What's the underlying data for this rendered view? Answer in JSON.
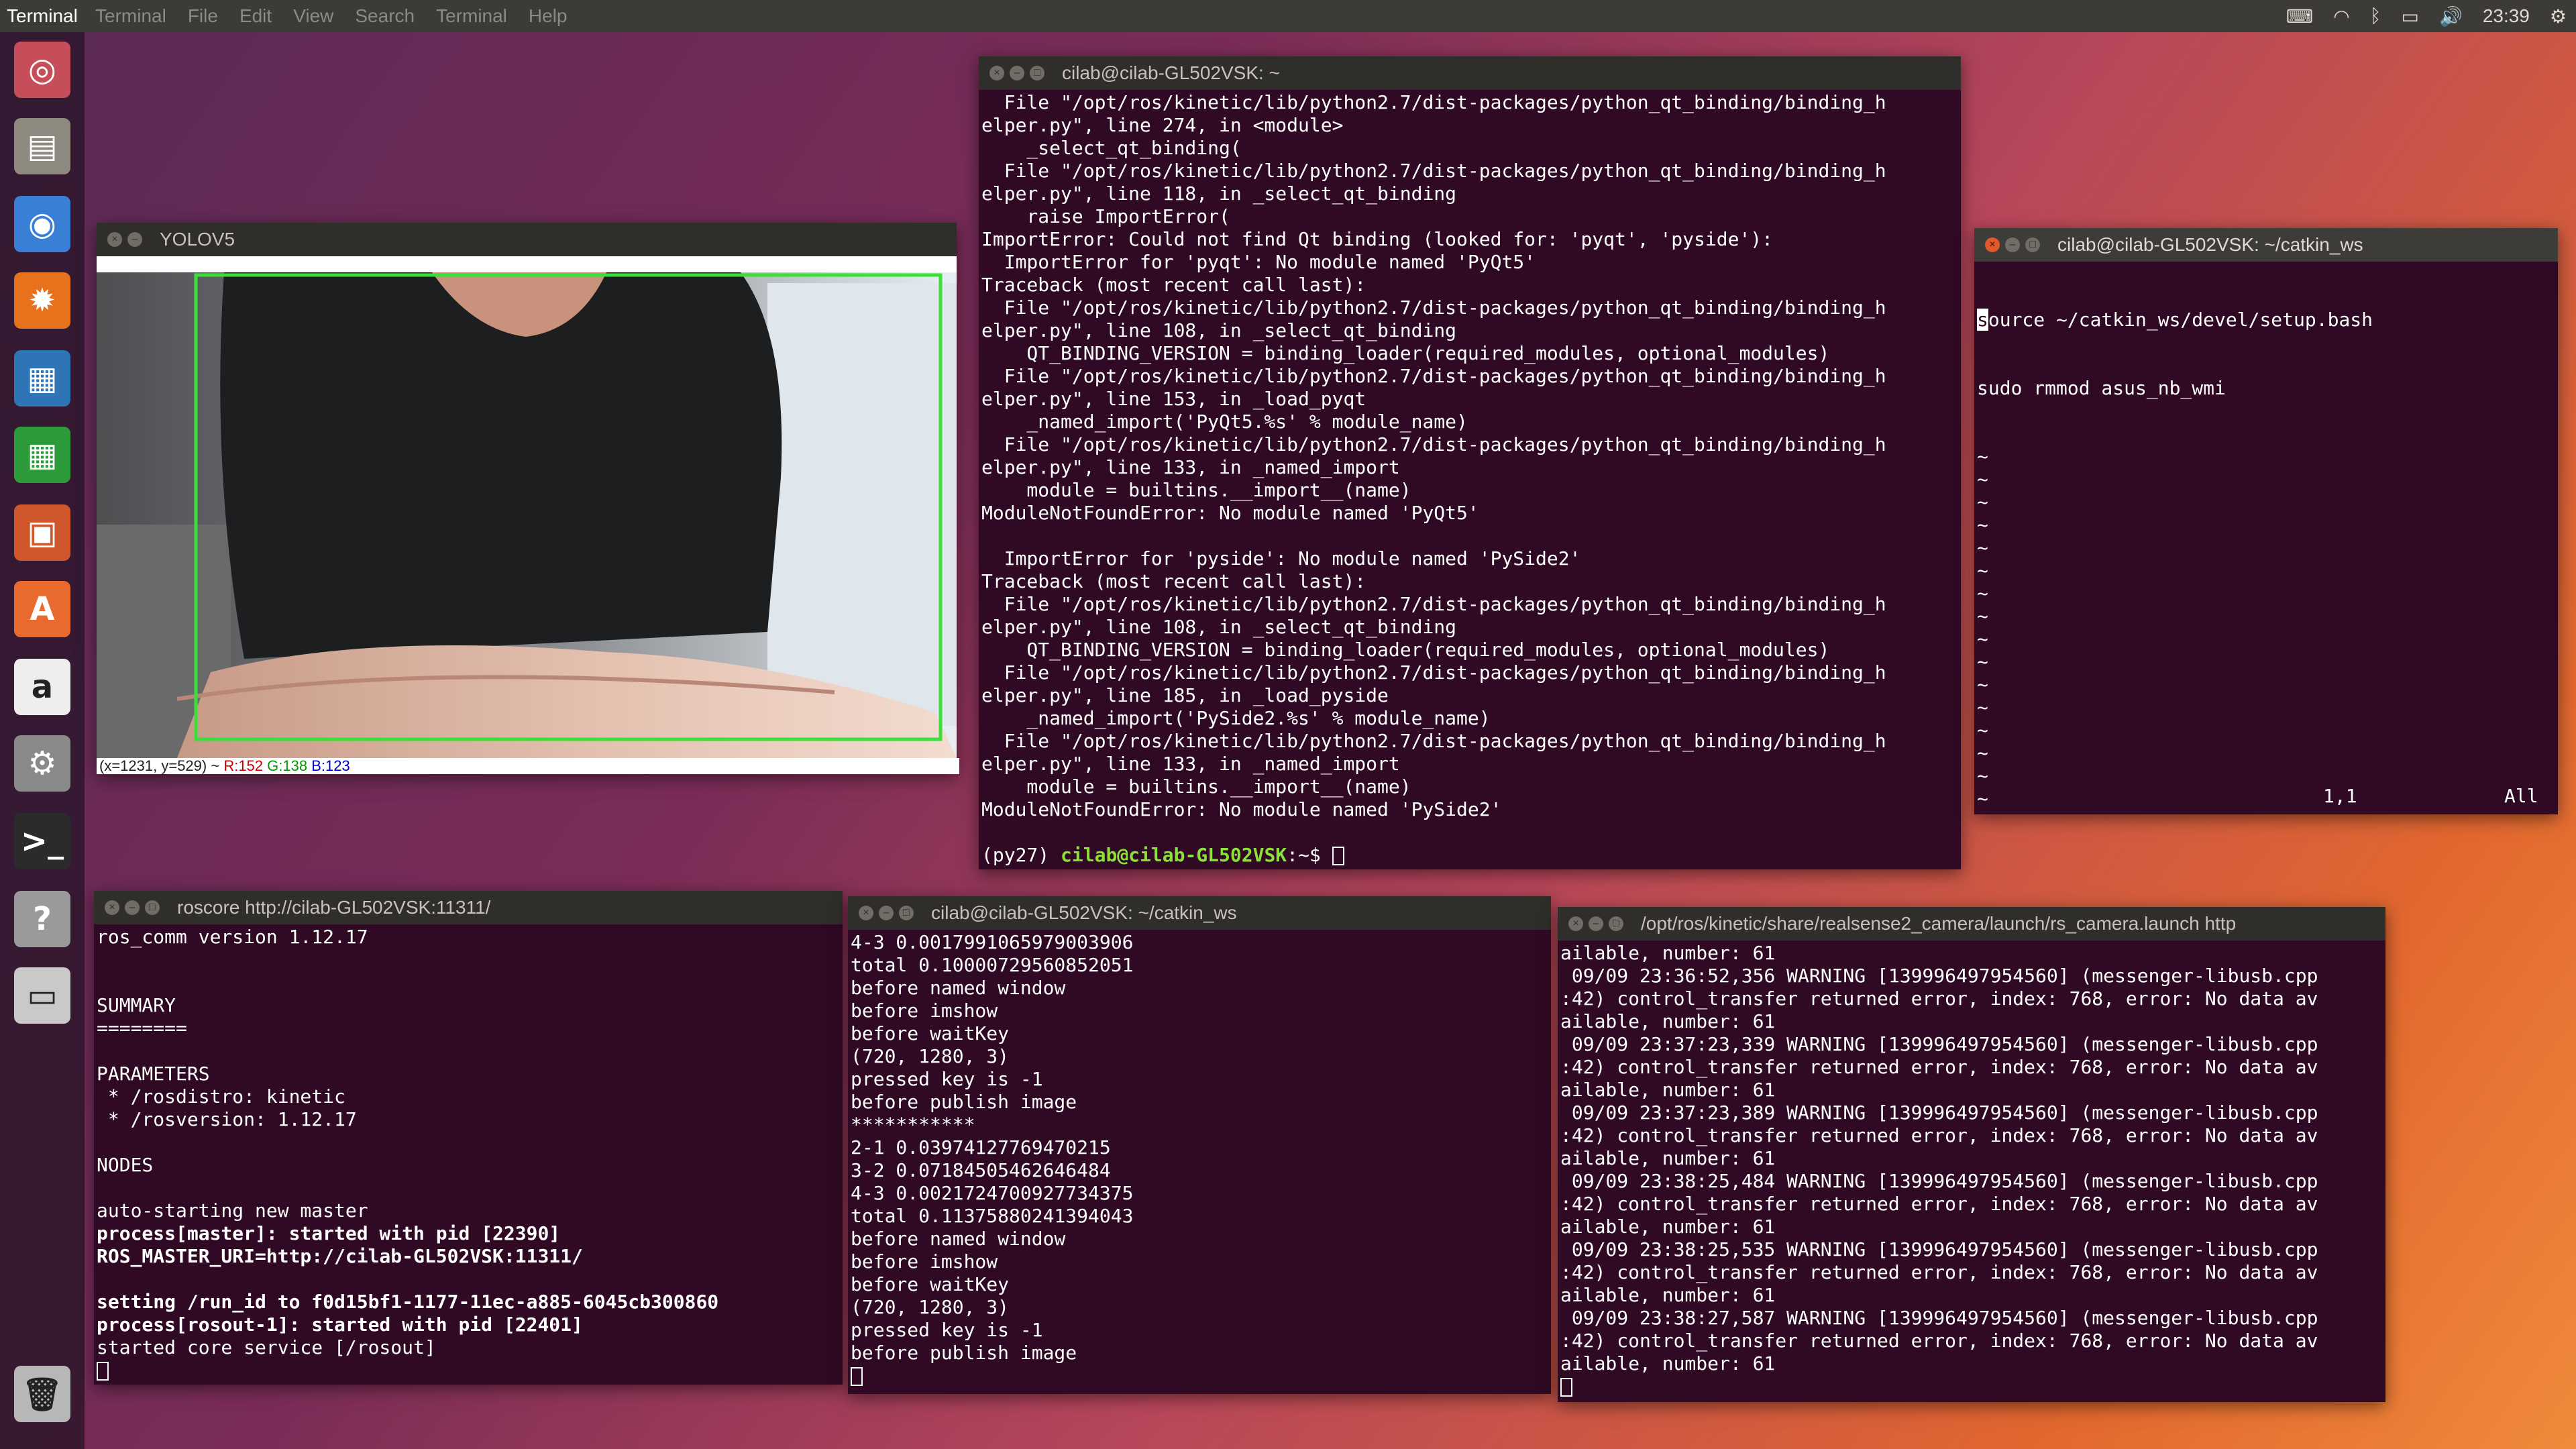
{
  "topbar": {
    "app_name": "Terminal",
    "menus": [
      "Terminal",
      "File",
      "Edit",
      "View",
      "Search",
      "Terminal",
      "Help"
    ],
    "clock": "23:39",
    "indicators": [
      "keyboard-icon",
      "wifi-icon",
      "bluetooth-icon",
      "battery-icon",
      "volume-icon",
      "settings-icon"
    ]
  },
  "launcher": {
    "items": [
      {
        "name": "ubuntu-icon",
        "glyph": "◎",
        "color": "#c64d5a"
      },
      {
        "name": "files-icon",
        "glyph": "▤",
        "color": "#8f8a80"
      },
      {
        "name": "chrome-icon",
        "glyph": "◉",
        "color": "#3a7fd6"
      },
      {
        "name": "firefox-icon",
        "glyph": "✹",
        "color": "#e8711c"
      },
      {
        "name": "libreoffice-writer-icon",
        "glyph": "▦",
        "color": "#2f74b5"
      },
      {
        "name": "libreoffice-calc-icon",
        "glyph": "▦",
        "color": "#2d9b3a"
      },
      {
        "name": "libreoffice-impress-icon",
        "glyph": "▣",
        "color": "#d0562b"
      },
      {
        "name": "software-center-icon",
        "glyph": "A",
        "color": "#e96a2e"
      },
      {
        "name": "amazon-icon",
        "glyph": "a",
        "color": "#eeeeee"
      },
      {
        "name": "system-settings-icon",
        "glyph": "⚙",
        "color": "#8a8a8a"
      },
      {
        "name": "terminal-icon",
        "glyph": ">_",
        "color": "#2b2b2b"
      },
      {
        "name": "help-icon",
        "glyph": "?",
        "color": "#9a9a9a"
      },
      {
        "name": "disk-icon",
        "glyph": "▭",
        "color": "#c9c9c9"
      },
      {
        "name": "trash-icon",
        "glyph": "🗑",
        "color": "#b7b7b7"
      }
    ]
  },
  "yolo": {
    "title": "YOLOV5",
    "status_coords": "(x=1231, y=529) ~",
    "status_r": "R:152",
    "status_g": "G:138",
    "status_b": "B:123"
  },
  "term_main": {
    "title": "cilab@cilab-GL502VSK: ~",
    "lines": [
      "  File \"/opt/ros/kinetic/lib/python2.7/dist-packages/python_qt_binding/binding_h",
      "elper.py\", line 274, in <module>",
      "    _select_qt_binding(",
      "  File \"/opt/ros/kinetic/lib/python2.7/dist-packages/python_qt_binding/binding_h",
      "elper.py\", line 118, in _select_qt_binding",
      "    raise ImportError(",
      "ImportError: Could not find Qt binding (looked for: 'pyqt', 'pyside'):",
      "  ImportError for 'pyqt': No module named 'PyQt5'",
      "Traceback (most recent call last):",
      "  File \"/opt/ros/kinetic/lib/python2.7/dist-packages/python_qt_binding/binding_h",
      "elper.py\", line 108, in _select_qt_binding",
      "    QT_BINDING_VERSION = binding_loader(required_modules, optional_modules)",
      "  File \"/opt/ros/kinetic/lib/python2.7/dist-packages/python_qt_binding/binding_h",
      "elper.py\", line 153, in _load_pyqt",
      "    _named_import('PyQt5.%s' % module_name)",
      "  File \"/opt/ros/kinetic/lib/python2.7/dist-packages/python_qt_binding/binding_h",
      "elper.py\", line 133, in _named_import",
      "    module = builtins.__import__(name)",
      "ModuleNotFoundError: No module named 'PyQt5'",
      "",
      "  ImportError for 'pyside': No module named 'PySide2'",
      "Traceback (most recent call last):",
      "  File \"/opt/ros/kinetic/lib/python2.7/dist-packages/python_qt_binding/binding_h",
      "elper.py\", line 108, in _select_qt_binding",
      "    QT_BINDING_VERSION = binding_loader(required_modules, optional_modules)",
      "  File \"/opt/ros/kinetic/lib/python2.7/dist-packages/python_qt_binding/binding_h",
      "elper.py\", line 185, in _load_pyside",
      "    _named_import('PySide2.%s' % module_name)",
      "  File \"/opt/ros/kinetic/lib/python2.7/dist-packages/python_qt_binding/binding_h",
      "elper.py\", line 133, in _named_import",
      "    module = builtins.__import__(name)",
      "ModuleNotFoundError: No module named 'PySide2'",
      ""
    ],
    "prompt_env": "(py27) ",
    "prompt_user": "cilab@cilab-GL502VSK",
    "prompt_tail": ":~$ "
  },
  "term_vim": {
    "title": "cilab@cilab-GL502VSK: ~/catkin_ws",
    "line1": "ource ~/catkin_ws/devel/setup.bash",
    "line1_first": "s",
    "line2": "sudo rmmod asus_nb_wmi",
    "tilde": "~",
    "pos": "1,1",
    "scroll": "All"
  },
  "term_roscore": {
    "title": "roscore http://cilab-GL502VSK:11311/",
    "lines": [
      {
        "t": "ros_comm version 1.12.17",
        "b": false
      },
      {
        "t": "",
        "b": false
      },
      {
        "t": "",
        "b": false
      },
      {
        "t": "SUMMARY",
        "b": false
      },
      {
        "t": "========",
        "b": false
      },
      {
        "t": "",
        "b": false
      },
      {
        "t": "PARAMETERS",
        "b": false
      },
      {
        "t": " * /rosdistro: kinetic",
        "b": false
      },
      {
        "t": " * /rosversion: 1.12.17",
        "b": false
      },
      {
        "t": "",
        "b": false
      },
      {
        "t": "NODES",
        "b": false
      },
      {
        "t": "",
        "b": false
      },
      {
        "t": "auto-starting new master",
        "b": false
      },
      {
        "t": "process[master]: started with pid [22390]",
        "b": true
      },
      {
        "t": "ROS_MASTER_URI=http://cilab-GL502VSK:11311/",
        "b": true
      },
      {
        "t": "",
        "b": false
      },
      {
        "t": "setting /run_id to f0d15bf1-1177-11ec-a885-6045cb300860",
        "b": true
      },
      {
        "t": "process[rosout-1]: started with pid [22401]",
        "b": true
      },
      {
        "t": "started core service [/rosout]",
        "b": false
      }
    ]
  },
  "term_catkin": {
    "title": "cilab@cilab-GL502VSK: ~/catkin_ws",
    "lines": [
      "4-3 0.0017991065979003906",
      "total 0.10000729560852051",
      "before named window",
      "before imshow",
      "before waitKey",
      "(720, 1280, 3)",
      "pressed key is -1",
      "before publish image",
      "***********",
      "2-1 0.03974127769470215",
      "3-2 0.07184505462646484",
      "4-3 0.0021724700927734375",
      "total 0.11375880241394043",
      "before named window",
      "before imshow",
      "before waitKey",
      "(720, 1280, 3)",
      "pressed key is -1",
      "before publish image"
    ]
  },
  "term_realsense": {
    "title": "/opt/ros/kinetic/share/realsense2_camera/launch/rs_camera.launch http",
    "lines": [
      "ailable, number: 61",
      " 09/09 23:36:52,356 WARNING [139996497954560] (messenger-libusb.cpp",
      ":42) control_transfer returned error, index: 768, error: No data av",
      "ailable, number: 61",
      " 09/09 23:37:23,339 WARNING [139996497954560] (messenger-libusb.cpp",
      ":42) control_transfer returned error, index: 768, error: No data av",
      "ailable, number: 61",
      " 09/09 23:37:23,389 WARNING [139996497954560] (messenger-libusb.cpp",
      ":42) control_transfer returned error, index: 768, error: No data av",
      "ailable, number: 61",
      " 09/09 23:38:25,484 WARNING [139996497954560] (messenger-libusb.cpp",
      ":42) control_transfer returned error, index: 768, error: No data av",
      "ailable, number: 61",
      " 09/09 23:38:25,535 WARNING [139996497954560] (messenger-libusb.cpp",
      ":42) control_transfer returned error, index: 768, error: No data av",
      "ailable, number: 61",
      " 09/09 23:38:27,587 WARNING [139996497954560] (messenger-libusb.cpp",
      ":42) control_transfer returned error, index: 768, error: No data av",
      "ailable, number: 61"
    ]
  }
}
